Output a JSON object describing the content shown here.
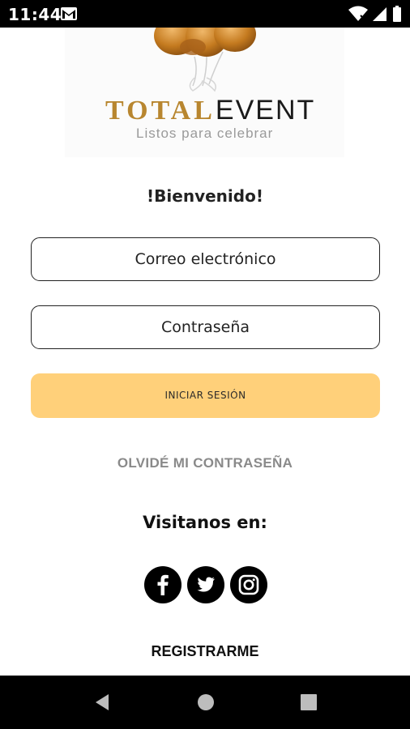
{
  "status_bar": {
    "time": "11:44",
    "icons": [
      "gmail-icon",
      "wifi-icon",
      "cellular-signal-icon",
      "battery-icon"
    ]
  },
  "logo": {
    "word_total": "TOTAL",
    "word_event": "EVENT",
    "tagline": "Listos para celebrar",
    "colors": {
      "gold": "#b8862f",
      "dark": "#1a1a1a"
    }
  },
  "login": {
    "welcome": "!Bienvenido!",
    "email_placeholder": "Correo electrónico",
    "password_placeholder": "Contraseña",
    "submit_label": "INICIAR SESIÓN",
    "forgot_label": "OLVIDÉ MI CONTRASEÑA"
  },
  "social": {
    "title": "Visitanos en:",
    "icons": [
      "facebook-icon",
      "twitter-icon",
      "instagram-icon"
    ]
  },
  "register_label": "REGISTRARME",
  "nav_bar": {
    "icons": [
      "back-icon",
      "home-icon",
      "recents-icon"
    ]
  },
  "colors": {
    "accent": "#ffd07a",
    "muted_text": "#8a8a8a",
    "background": "#ffffff"
  }
}
